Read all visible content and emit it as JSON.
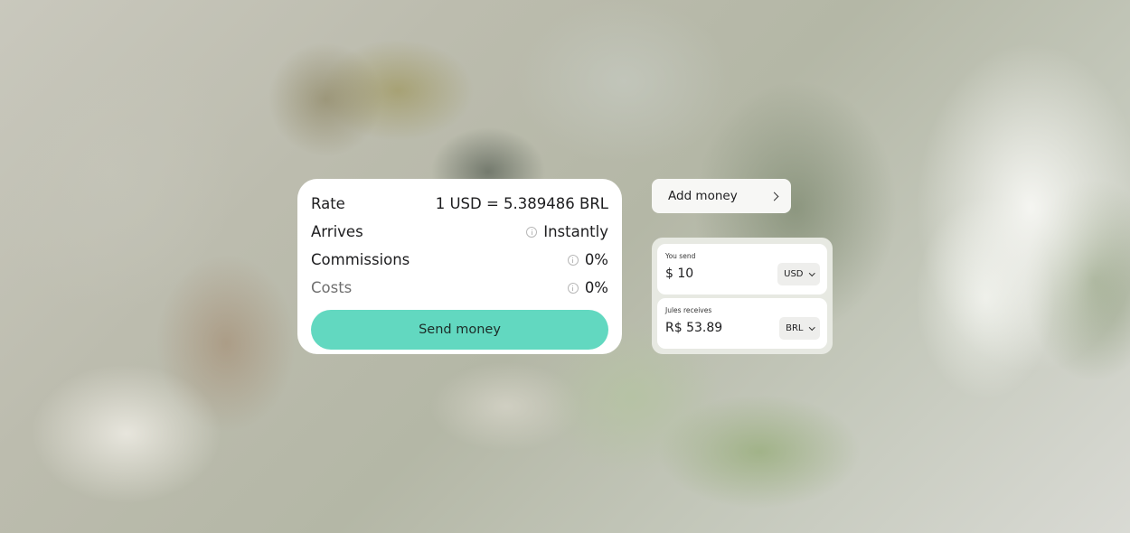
{
  "rate_card": {
    "rows": [
      {
        "label": "Rate",
        "value": "1 USD = 5.389486 BRL"
      },
      {
        "label": "Arrives",
        "value": "Instantly"
      },
      {
        "label": "Commissions",
        "value": "0%"
      },
      {
        "label": "Costs",
        "value": "0%"
      }
    ],
    "send_button_label": "Send money",
    "button_color": "#62d8c0"
  },
  "add_money": {
    "label": "Add money",
    "icon": "chevron-right-icon"
  },
  "converter": {
    "send": {
      "label": "You send",
      "amount": "$ 10",
      "currency": "USD"
    },
    "receive": {
      "label": "Jules receives",
      "amount": "R$ 53.89",
      "currency": "BRL"
    }
  }
}
